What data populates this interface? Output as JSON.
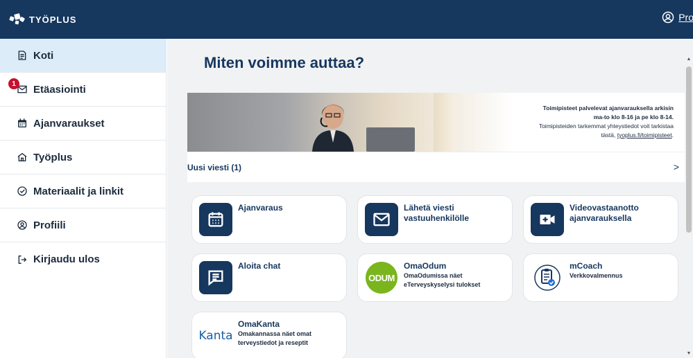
{
  "header": {
    "logo_text": "TYÖPLUS",
    "profile_label": "Profi"
  },
  "sidebar": {
    "items": [
      {
        "label": "Koti",
        "icon": "document-icon",
        "active": true
      },
      {
        "label": "Etäasiointi",
        "icon": "envelope-icon",
        "badge": "1"
      },
      {
        "label": "Ajanvaraukset",
        "icon": "calendar-icon"
      },
      {
        "label": "Työplus",
        "icon": "home-icon"
      },
      {
        "label": "Materiaalit ja linkit",
        "icon": "check-circle-icon"
      },
      {
        "label": "Profiili",
        "icon": "user-circle-icon"
      },
      {
        "label": "Kirjaudu ulos",
        "icon": "logout-icon"
      }
    ]
  },
  "main": {
    "title": "Miten voimme auttaa?",
    "banner": {
      "line1": "Toimipisteet palvelevat ajanvarauksella arkisin",
      "line2": "ma-to klo 8-16 ja pe klo 8-14.",
      "line3": "Toimipisteiden tarkemmat yhteystiedot voit tarkistaa",
      "line4_prefix": "tästä, ",
      "link": "tyoplus.fi/toimipisteet",
      "line4_suffix": "."
    },
    "new_message": {
      "label": "Uusi viesti (1)",
      "chevron": ">"
    },
    "cards": [
      {
        "title": "Ajanvaraus",
        "subtitle": "",
        "icon": "calendar-icon"
      },
      {
        "title": "Lähetä viesti vastuuhenkilölle",
        "subtitle": "",
        "icon": "envelope-icon"
      },
      {
        "title": "Videovastaanotto ajanvarauksella",
        "subtitle": "",
        "icon": "video-icon"
      },
      {
        "title": "Aloita chat",
        "subtitle": "",
        "icon": "chat-icon"
      },
      {
        "title": "OmaOdum",
        "subtitle": "OmaOdumissa näet eTerveyskyselysi tulokset",
        "icon": "odum-logo",
        "logo_text": "ODUM"
      },
      {
        "title": "mCoach",
        "subtitle": "Verkkovalmennus",
        "icon": "clipboard-check-icon"
      },
      {
        "title": "OmaKanta",
        "subtitle": "Omakannassa näet omat terveystiedot ja reseptit",
        "icon": "kanta-logo",
        "logo_text": "Kanta"
      }
    ]
  },
  "colors": {
    "header_bg": "#16375e",
    "active_nav": "#dcecf8",
    "badge": "#c8102e",
    "main_bg": "#f1f2f4",
    "odum_green": "#7ab51d"
  }
}
